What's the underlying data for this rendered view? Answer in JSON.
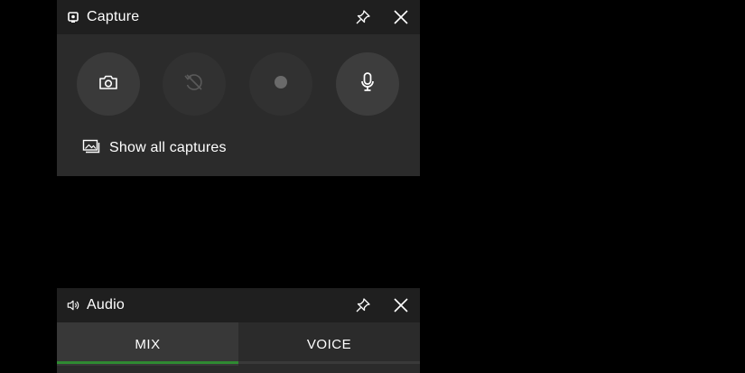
{
  "capture": {
    "title": "Capture",
    "title_icon": "capture-widget-icon",
    "pin_icon": "pin-icon",
    "close_icon": "close-icon",
    "buttons": [
      {
        "icon": "camera-icon",
        "state": "enabled"
      },
      {
        "icon": "record-last-30s-icon",
        "state": "disabled"
      },
      {
        "icon": "record-dot-icon",
        "state": "disabled"
      },
      {
        "icon": "microphone-icon",
        "state": "enabled"
      }
    ],
    "show_all_label": "Show all captures",
    "show_all_icon": "gallery-icon"
  },
  "audio": {
    "title": "Audio",
    "title_icon": "speaker-icon",
    "pin_icon": "pin-icon",
    "close_icon": "close-icon",
    "tabs": [
      {
        "label": "MIX",
        "selected": true
      },
      {
        "label": "VOICE",
        "selected": false
      }
    ]
  },
  "colors": {
    "background": "#000000",
    "widget": "#2b2b2b",
    "titlebar": "#1f1f1f",
    "accent": "#2f8a32"
  }
}
